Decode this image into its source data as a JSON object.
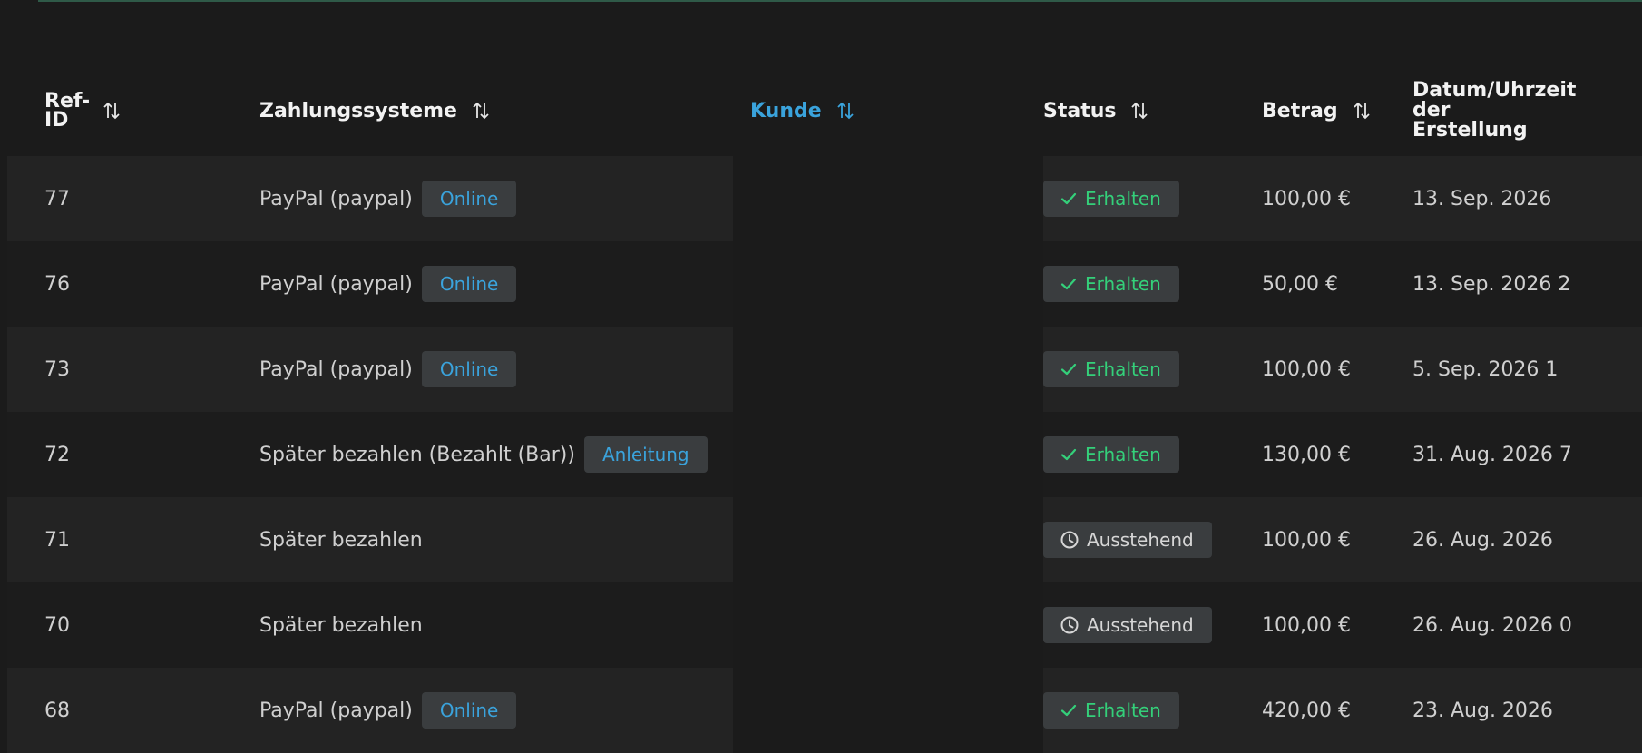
{
  "columns": {
    "ref": "Ref-ID",
    "zahlung": "Zahlungssysteme",
    "kunde": "Kunde",
    "status": "Status",
    "betrag": "Betrag",
    "datum": "Datum/Uhrzeit der Erstellung"
  },
  "colors": {
    "accent": "#3aa3dc",
    "success": "#34d07a",
    "badge_bg": "#3a3d3f"
  },
  "rows": [
    {
      "ref": "77",
      "method": "PayPal (paypal)",
      "badge": "Online",
      "status": "Erhalten",
      "status_icon": "check-icon",
      "amount": "100,00 €",
      "date": "13. Sep. 2026"
    },
    {
      "ref": "76",
      "method": "PayPal (paypal)",
      "badge": "Online",
      "status": "Erhalten",
      "status_icon": "check-icon",
      "amount": "50,00 €",
      "date": "13. Sep. 2026 2"
    },
    {
      "ref": "73",
      "method": "PayPal (paypal)",
      "badge": "Online",
      "status": "Erhalten",
      "status_icon": "check-icon",
      "amount": "100,00 €",
      "date": "5. Sep. 2026 1"
    },
    {
      "ref": "72",
      "method": "Später bezahlen (Bezahlt (Bar))",
      "badge": "Anleitung",
      "status": "Erhalten",
      "status_icon": "check-icon",
      "amount": "130,00 €",
      "date": "31. Aug. 2026 7"
    },
    {
      "ref": "71",
      "method": "Später bezahlen",
      "badge": "",
      "status": "Ausstehend",
      "status_icon": "clock-icon",
      "amount": "100,00 €",
      "date": "26. Aug. 2026"
    },
    {
      "ref": "70",
      "method": "Später bezahlen",
      "badge": "",
      "status": "Ausstehend",
      "status_icon": "clock-icon",
      "amount": "100,00 €",
      "date": "26. Aug. 2026 0"
    },
    {
      "ref": "68",
      "method": "PayPal (paypal)",
      "badge": "Online",
      "status": "Erhalten",
      "status_icon": "check-icon",
      "amount": "420,00 €",
      "date": "23. Aug. 2026"
    }
  ]
}
